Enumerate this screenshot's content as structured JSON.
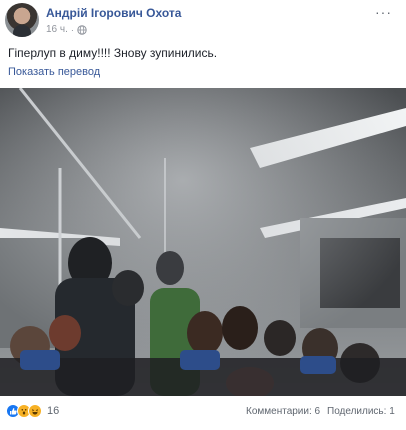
{
  "post": {
    "author": "Андрій Ігорович Охота",
    "time": "16 ч.",
    "separator": "·",
    "more_label": "···",
    "text": "Гіперлуп в диму!!!! Знову зупинились.",
    "translate_link": "Показать перевод"
  },
  "footer": {
    "reaction_count": "16",
    "comments": "Комментарии: 6",
    "shares": "Поделились: 1"
  },
  "icons": {
    "privacy": "globe-icon",
    "reactions": [
      "like-icon",
      "wow-icon",
      "haha-icon"
    ]
  },
  "colors": {
    "link": "#385898",
    "meta": "#90949c",
    "like": "#1877f2",
    "emoji": "#f7b125"
  }
}
